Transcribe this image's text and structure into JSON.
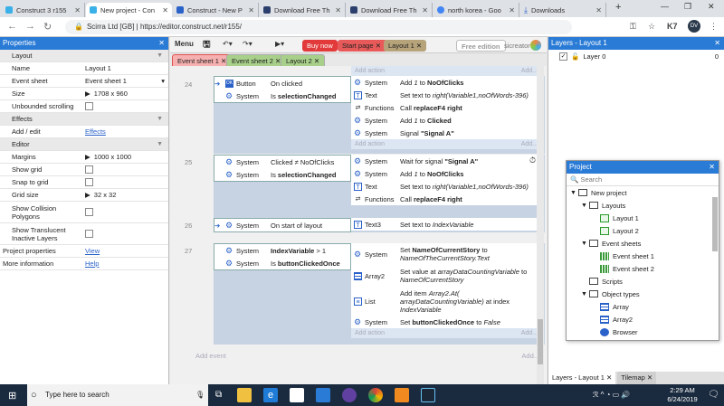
{
  "browser": {
    "tabs": [
      {
        "label": "Construct 3 r155",
        "color": "#3ab0e8"
      },
      {
        "label": "New project - Con",
        "color": "#3ab0e8"
      },
      {
        "label": "Construct - New P",
        "color": "#2a62c9"
      },
      {
        "label": "Download Free Th",
        "color": "#2c3e6b"
      },
      {
        "label": "Download Free Th",
        "color": "#2c3e6b"
      },
      {
        "label": "north korea - Goo",
        "color": "#4285f4"
      },
      {
        "label": "Downloads",
        "color": "#2a62c9"
      }
    ],
    "new_tab": "+",
    "url_host": "Scirra Ltd [GB]",
    "url": "https://editor.construct.net/r155/",
    "profile": "DV"
  },
  "toolbar": {
    "menu": "Menu",
    "buy_now": "Buy now",
    "start_page": "Start page",
    "layout_tab": "Layout 1",
    "free_edition": "Free edition",
    "user": "sicreator"
  },
  "doc_tabs": [
    {
      "label": "Event sheet 1"
    },
    {
      "label": "Event sheet 2"
    },
    {
      "label": "Layout 2"
    }
  ],
  "properties": {
    "title": "Properties",
    "rows": [
      {
        "type": "section",
        "label": "Layout"
      },
      {
        "k": "Name",
        "v": "Layout 1"
      },
      {
        "k": "Event sheet",
        "v": "Event sheet 1"
      },
      {
        "k": "Size",
        "v": "1708 x 960"
      },
      {
        "k": "Unbounded scrolling",
        "v": ""
      },
      {
        "type": "section",
        "label": "Effects"
      },
      {
        "k": "Add / edit",
        "v": "Effects"
      },
      {
        "type": "section",
        "label": "Editor"
      },
      {
        "k": "Margins",
        "v": "1000 x 1000"
      },
      {
        "k": "Show grid",
        "v": ""
      },
      {
        "k": "Snap to grid",
        "v": ""
      },
      {
        "k": "Grid size",
        "v": "32 x 32"
      },
      {
        "k": "Show Collision Polygons",
        "v": ""
      },
      {
        "k": "Show Translucent Inactive Layers",
        "v": ""
      },
      {
        "k": "Project properties",
        "v": "View"
      },
      {
        "k": "More information",
        "v": "Help"
      }
    ]
  },
  "events": {
    "add_action": "Add action",
    "add_event": "Add event",
    "e24": {
      "num": "24",
      "c1_obj": "Button",
      "c1_txt": "On clicked",
      "c2_obj": "System",
      "c2_pre": "Is ",
      "c2_b": "selectionChanged",
      "a": [
        {
          "obj": "System",
          "pre": "Add ",
          "i": "1",
          "mid": " to ",
          "b": "NoOfClicks"
        },
        {
          "obj": "Text",
          "pre": "Set text to ",
          "i": "right(Variable1,noOfWords-396)"
        },
        {
          "obj": "Functions",
          "pre": "Call ",
          "b": "replaceF4 right"
        },
        {
          "obj": "System",
          "pre": "Add ",
          "i": "1",
          "mid": " to ",
          "b": "Clicked"
        },
        {
          "obj": "System",
          "pre": "Signal ",
          "b": "\"Signal A\""
        }
      ]
    },
    "e25": {
      "num": "25",
      "c1_obj": "System",
      "c1_txt": "Clicked ≠ NoOfClicks",
      "c2_obj": "System",
      "c2_pre": "Is ",
      "c2_b": "selectionChanged",
      "a": [
        {
          "obj": "System",
          "pre": "Wait for signal ",
          "b": "\"Signal A\""
        },
        {
          "obj": "System",
          "pre": "Add ",
          "i": "1",
          "mid": " to ",
          "b": "NoOfClicks"
        },
        {
          "obj": "Text",
          "pre": "Set text to ",
          "i": "right(Variable1,noOfWords-396)"
        },
        {
          "obj": "Functions",
          "pre": "Call ",
          "b": "replaceF4 right"
        }
      ]
    },
    "e26": {
      "num": "26",
      "c1_obj": "System",
      "c1_txt": "On start of layout",
      "a_obj": "Text3",
      "a_pre": "Set text to ",
      "a_i": "IndexVariable"
    },
    "e27": {
      "num": "27",
      "c1_obj": "System",
      "c1_b": "IndexVariable",
      "c1_rest": " > 1",
      "c2_obj": "System",
      "c2_pre": "Is ",
      "c2_b": "buttonClickedOnce",
      "a1_obj": "System",
      "a1_pre": "Set ",
      "a1_b": "NameOfCurrentStory",
      "a1_mid": " to ",
      "a1_i": "NameOfTheCurrentStory.Text",
      "a2_obj": "Array2",
      "a2_pre": "Set value at ",
      "a2_i": "arrayDataCountingVariable",
      "a2_mid": " to ",
      "a2_i2": "NameOfCurrentStory",
      "a3_obj": "List",
      "a3_pre": "Add item ",
      "a3_i": "Array2.At( arrayDataCountingVariable)",
      "a3_mid": " at index ",
      "a3_i2": "IndexVariable",
      "a4_obj": "System",
      "a4_pre": "Set ",
      "a4_b": "buttonClickedOnce",
      "a4_mid": " to ",
      "a4_i": "False"
    }
  },
  "layers": {
    "title": "Layers - Layout 1",
    "layer0": "Layer 0",
    "layer0_count": "0",
    "bottom_tab1": "Layers - Layout 1",
    "bottom_tab2": "Tilemap"
  },
  "project": {
    "title": "Project",
    "search": "Search",
    "items": [
      {
        "label": "New project",
        "level": 0,
        "kind": "folder"
      },
      {
        "label": "Layouts",
        "level": 1,
        "kind": "folder"
      },
      {
        "label": "Layout 1",
        "level": 2,
        "kind": "layout"
      },
      {
        "label": "Layout 2",
        "level": 2,
        "kind": "layout"
      },
      {
        "label": "Event sheets",
        "level": 1,
        "kind": "folder"
      },
      {
        "label": "Event sheet 1",
        "level": 2,
        "kind": "event"
      },
      {
        "label": "Event sheet 2",
        "level": 2,
        "kind": "event"
      },
      {
        "label": "Scripts",
        "level": 1,
        "kind": "folder-plain"
      },
      {
        "label": "Object types",
        "level": 1,
        "kind": "folder"
      },
      {
        "label": "Array",
        "level": 2,
        "kind": "array"
      },
      {
        "label": "Array2",
        "level": 2,
        "kind": "array"
      },
      {
        "label": "Browser",
        "level": 2,
        "kind": "browser"
      }
    ]
  },
  "taskbar": {
    "search_placeholder": "Type here to search",
    "time": "2:29 AM",
    "date": "6/24/2019"
  }
}
